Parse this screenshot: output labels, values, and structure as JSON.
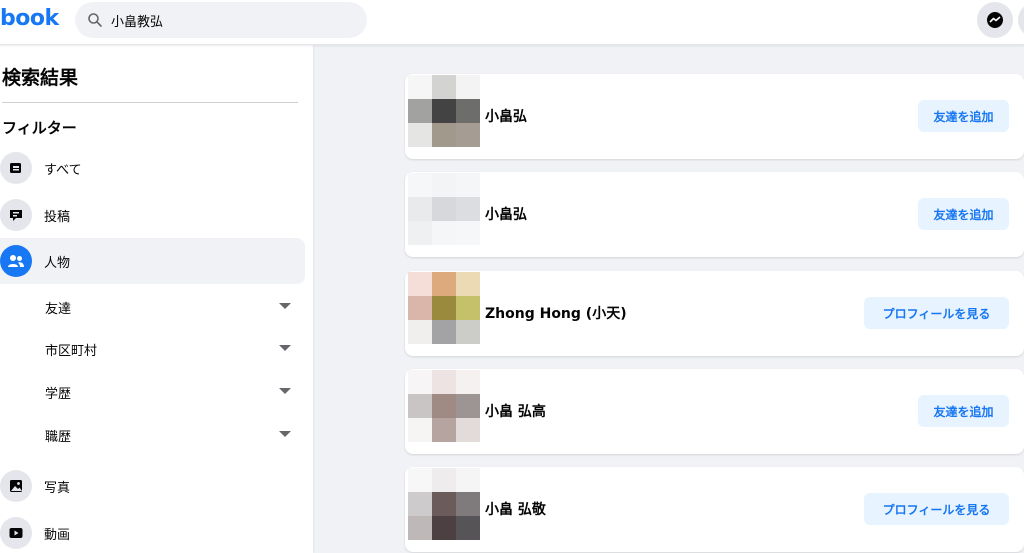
{
  "header": {
    "logo": "book",
    "search_value": "小畠教弘"
  },
  "sidebar": {
    "title": "検索結果",
    "filter_heading": "フィルター",
    "items": [
      {
        "label": "すべて",
        "icon": "feed-icon"
      },
      {
        "label": "投稿",
        "icon": "post-icon"
      },
      {
        "label": "人物",
        "icon": "people-icon",
        "active": true
      },
      {
        "label": "写真",
        "icon": "photo-icon"
      },
      {
        "label": "動画",
        "icon": "video-icon"
      }
    ],
    "people_filters": [
      {
        "label": "友達"
      },
      {
        "label": "市区町村"
      },
      {
        "label": "学歴"
      },
      {
        "label": "職歴"
      }
    ]
  },
  "results": [
    {
      "name": "小畠弘",
      "button": "友達を追加"
    },
    {
      "name": "小畠弘",
      "button": "友達を追加"
    },
    {
      "name": "Zhong Hong (小天)",
      "button": "プロフィールを見る"
    },
    {
      "name": "小畠 弘高",
      "button": "友達を追加"
    },
    {
      "name": "小畠 弘敬",
      "button": "プロフィールを見る"
    }
  ],
  "colors": {
    "brand": "#1877f2",
    "background": "#f0f2f5",
    "button_bg": "#e7f3ff"
  }
}
